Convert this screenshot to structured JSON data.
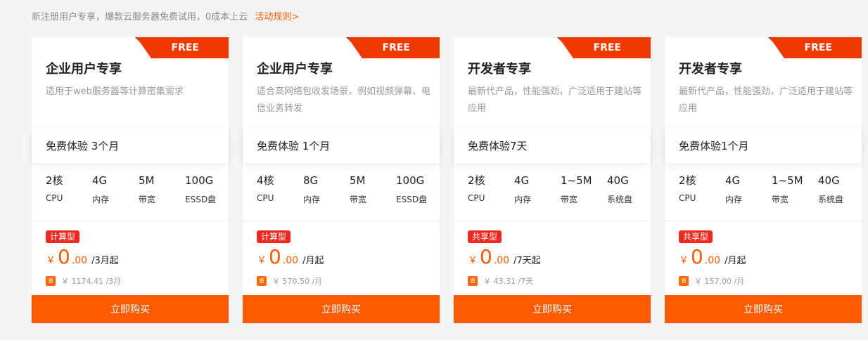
{
  "top_note": {
    "text": "新注册用户专享，爆款云服务器免费试用，0成本上云",
    "link": "活动规则>"
  },
  "colors": {
    "accent": "#ff5a00",
    "ribbon": "#ee3a00",
    "tag": "#ee2a20"
  },
  "cards": [
    {
      "ribbon": "FREE",
      "title": "企业用户专享",
      "desc": "适用于web服务器等计算密集需求",
      "trial": "免费体验 3个月",
      "specs": [
        {
          "value": "2核",
          "name": "CPU"
        },
        {
          "value": "4G",
          "name": "内存"
        },
        {
          "value": "5M",
          "name": "带宽"
        },
        {
          "value": "100G",
          "name": "ESSD盘"
        }
      ],
      "tag": "计算型",
      "price": {
        "currency": "￥",
        "int": "0",
        "dec": ".00",
        "unit": "/3月起"
      },
      "save_icon": "省",
      "orig": "￥ 1174.41 /3月",
      "buy": "立即购买"
    },
    {
      "ribbon": "FREE",
      "title": "企业用户专享",
      "desc": "适合高网络包收发场景，例如视频弹幕、电信业务转发",
      "trial": "免费体验 1个月",
      "specs": [
        {
          "value": "4核",
          "name": "CPU"
        },
        {
          "value": "8G",
          "name": "内存"
        },
        {
          "value": "5M",
          "name": "带宽"
        },
        {
          "value": "100G",
          "name": "ESSD盘"
        }
      ],
      "tag": "计算型",
      "price": {
        "currency": "￥",
        "int": "0",
        "dec": ".00",
        "unit": "/月起"
      },
      "save_icon": "省",
      "orig": "￥ 570.50 /月",
      "buy": "立即购买"
    },
    {
      "ribbon": "FREE",
      "title": "开发者专享",
      "desc": "最新代产品，性能强劲，广泛适用于建站等应用",
      "trial": "免费体验7天",
      "specs": [
        {
          "value": "2核",
          "name": "CPU"
        },
        {
          "value": "4G",
          "name": "内存"
        },
        {
          "value": "1~5M",
          "name": "带宽"
        },
        {
          "value": "40G",
          "name": "系统盘"
        }
      ],
      "tag": "共享型",
      "price": {
        "currency": "￥",
        "int": "0",
        "dec": ".00",
        "unit": "/7天起"
      },
      "save_icon": "省",
      "orig": "￥ 43.31 /7天",
      "buy": "立即购买"
    },
    {
      "ribbon": "FREE",
      "title": "开发者专享",
      "desc": "最新代产品，性能强劲，广泛适用于建站等应用",
      "trial": "免费体验1个月",
      "specs": [
        {
          "value": "2核",
          "name": "CPU"
        },
        {
          "value": "4G",
          "name": "内存"
        },
        {
          "value": "1~5M",
          "name": "带宽"
        },
        {
          "value": "40G",
          "name": "系统盘"
        }
      ],
      "tag": "共享型",
      "price": {
        "currency": "￥",
        "int": "0",
        "dec": ".00",
        "unit": "/月起"
      },
      "save_icon": "省",
      "orig": "￥ 157.00 /月",
      "buy": "立即购买"
    }
  ]
}
